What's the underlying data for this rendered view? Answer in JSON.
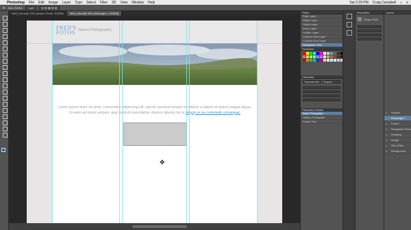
{
  "menubar": {
    "app": "Photoshop",
    "items": [
      "File",
      "Edit",
      "Image",
      "Layer",
      "Type",
      "Select",
      "Filter",
      "3D",
      "View",
      "Window",
      "Help"
    ],
    "clock": "Sat 2:29 PM",
    "user": "Craig Campbell"
  },
  "optbar": {
    "auto_select": "Auto-Select:",
    "target": "Layer"
  },
  "tabs": [
    {
      "label": "Web_Home@ 33% (Nature Photo, RGB/8)",
      "active": false
    },
    {
      "label": "Web_About@ 33% (Message 1, RGB/8)",
      "active": true
    }
  ],
  "page": {
    "logo_line1": "FRED'S",
    "logo_line2": "FOTOS",
    "tagline": "Nature Photography",
    "lorem_plain": "Lorem ipsum dolor sit amet, consectetur adipiscing elit, sed do eiusmod tempor incididunt ut labore et dolore magna aliqua. Ut enim ad minim veniam, quis nostrud exercitation ullamco laboris nisi ut",
    "lorem_link": "aliquip ex ea commodo consequat."
  },
  "panels": {
    "paths_title": "Paths",
    "paths": [
      "Path Layer",
      "Wake Layer",
      "Guide Layer",
      "Inner Layer",
      "Ladder Layer",
      "Custom Grid Layer",
      "Content Grid Layer",
      "Navigation Text"
    ],
    "swatches_title": "Swatches",
    "swatch_colors": [
      "#ff0000",
      "#ffff00",
      "#00ff00",
      "#00ffff",
      "#0000ff",
      "#ff00ff",
      "#ffffff",
      "#cccccc",
      "#999999",
      "#666666",
      "#333333",
      "#000000",
      "#ff6666",
      "#ffcc66",
      "#99ff66",
      "#66ffcc",
      "#6699ff",
      "#cc66ff",
      "#f5e6c8",
      "#c8a878",
      "#a07848",
      "#785030",
      "#503018",
      "#281808",
      "#cc0000",
      "#cc9900",
      "#33cc00",
      "#00cc99",
      "#0033cc",
      "#9900cc",
      "#ffcccc",
      "#ffffcc",
      "#ccffcc",
      "#ccffff",
      "#ccccff",
      "#ffccff"
    ],
    "character_title": "Character",
    "font_family": "Trebuchet MS",
    "font_style": "Regular",
    "layer_comps_title": "Paragraph Styles",
    "styles": [
      "Basic Paragraph",
      "Gallery Paragraph",
      "Footer Text"
    ],
    "properties_title": "Properties",
    "properties_layer": "Shape Path",
    "layers_title": "Layers",
    "layers": [
      "Header",
      "Rectangle 1",
      "Frame",
      "Navigation Elements",
      "Heading",
      "Image",
      "Slot (Title)",
      "Background"
    ]
  },
  "icons": [
    "apple-icon",
    "move-icon",
    "marquee-icon",
    "lasso-icon",
    "wand-icon",
    "crop-icon",
    "eyedropper-icon",
    "heal-icon",
    "brush-icon",
    "stamp-icon",
    "history-icon",
    "eraser-icon",
    "gradient-icon",
    "blur-icon",
    "dodge-icon",
    "pen-icon",
    "type-icon",
    "path-select-icon",
    "shape-icon",
    "hand-icon",
    "zoom-icon"
  ]
}
